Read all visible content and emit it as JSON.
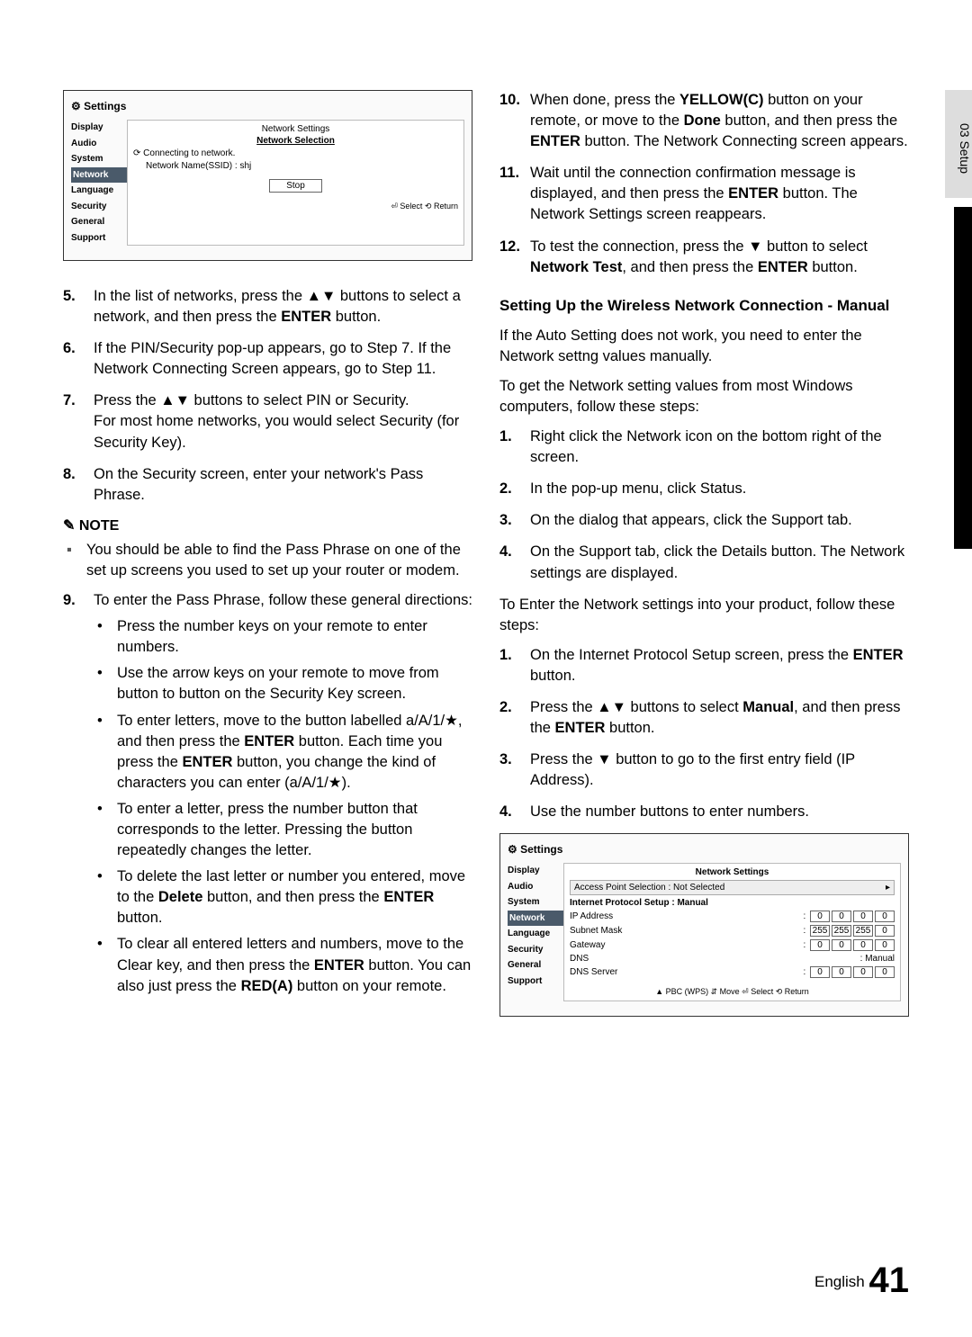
{
  "sideTab": "03  Setup",
  "screenshot1": {
    "title": "Settings",
    "menu": [
      "Display",
      "Audio",
      "System",
      "Network",
      "Language",
      "Security",
      "General",
      "Support"
    ],
    "heading": "Network Settings",
    "sub": "Network Selection",
    "connecting": "Connecting to network.",
    "ssid": "Network Name(SSID) : shj",
    "stop": "Stop",
    "footer": "⏎ Select   ⟲ Return"
  },
  "left": {
    "i5": {
      "n": "5.",
      "t": "In the list of networks, press the ▲▼ buttons to select a network, and then press the <b>ENTER</b> button."
    },
    "i6": {
      "n": "6.",
      "t": "If the PIN/Security pop-up appears, go to Step 7. If the Network Connecting Screen appears, go to Step 11."
    },
    "i7": {
      "n": "7.",
      "t": "Press the ▲▼ buttons to select PIN or Security.<br>For most home networks, you would select Security (for Security Key)."
    },
    "i8": {
      "n": "8.",
      "t": "On the Security screen, enter your network's Pass Phrase."
    },
    "noteLabel": "NOTE",
    "note": "You should be able to find the Pass Phrase on one of the set up screens you used to set up your router or modem.",
    "i9": {
      "n": "9.",
      "t": "To enter the Pass Phrase, follow these general directions:"
    },
    "b1": "Press the number keys on your remote to enter numbers.",
    "b2": "Use the arrow keys on your remote to move from button to button on the Security Key screen.",
    "b3": "To enter letters, move to the button labelled a/A/1/★, and then press the <b>ENTER</b> button. Each time you press the <b>ENTER</b> button, you change the kind of characters you can enter (a/A/1/★).",
    "b4": "To enter a letter, press the number button that corresponds to the letter. Pressing the button repeatedly changes the letter.",
    "b5": "To delete the last letter or number you entered, move to the <b>Delete</b> button, and then press the <b>ENTER</b> button.",
    "b6": "To clear all entered letters and numbers, move to the Clear key, and then press the <b>ENTER</b> button. You can also just press the <b>RED(A)</b> button on your remote."
  },
  "right": {
    "i10": {
      "n": "10.",
      "t": "When done, press the <b>YELLOW(C)</b> button on your remote, or move to the <b>Done</b> button, and then press the <b>ENTER</b> button. The Network Connecting screen appears."
    },
    "i11": {
      "n": "11.",
      "t": "Wait until the connection confirmation message is displayed, and then press the <b>ENTER</b> button. The Network Settings screen reappears."
    },
    "i12": {
      "n": "12.",
      "t": "To test the connection, press the ▼ button to select <b>Network Test</b>, and then press the <b>ENTER</b> button."
    },
    "secTitle": "Setting Up the Wireless Network Connection - Manual",
    "p1": "If the Auto Setting does not work, you need to enter the Network settng values manually.",
    "p2": "To get the Network setting values from most Windows computers, follow these steps:",
    "s1": {
      "n": "1.",
      "t": "Right click the Network icon on the bottom right of the screen."
    },
    "s2": {
      "n": "2.",
      "t": "In the pop-up menu, click Status."
    },
    "s3": {
      "n": "3.",
      "t": "On the dialog that appears, click the Support tab."
    },
    "s4": {
      "n": "4.",
      "t": "On the Support tab, click the Details button. The Network settings are displayed."
    },
    "p3": "To Enter the Network settings into your product, follow these steps:",
    "t1": {
      "n": "1.",
      "t": "On the Internet Protocol Setup screen, press the <b>ENTER</b> button."
    },
    "t2": {
      "n": "2.",
      "t": "Press the ▲▼ buttons to select <b>Manual</b>, and then press the <b>ENTER</b> button."
    },
    "t3": {
      "n": "3.",
      "t": "Press the ▼ button to go to the first entry field (IP Address)."
    },
    "t4": {
      "n": "4.",
      "t": "Use the number buttons to enter numbers."
    }
  },
  "screenshot2": {
    "title": "Settings",
    "menu": [
      "Display",
      "Audio",
      "System",
      "Network",
      "Language",
      "Security",
      "General",
      "Support"
    ],
    "heading": "Network Settings",
    "aps": "Access Point Selection : Not Selected",
    "ips": "Internet Protocol Setup : Manual",
    "ip_label": "IP Address",
    "ip": [
      "0",
      "0",
      "0",
      "0"
    ],
    "sm_label": "Subnet Mask",
    "sm": [
      "255",
      "255",
      "255",
      "0"
    ],
    "gw_label": "Gateway",
    "gw": [
      "0",
      "0",
      "0",
      "0"
    ],
    "dns_label": "DNS",
    "dns_val": ": Manual",
    "ds_label": "DNS Server",
    "ds": [
      "0",
      "0",
      "0",
      "0"
    ],
    "footer": "▲ PBC (WPS)   ⇵ Move   ⏎ Select   ⟲ Return"
  },
  "footer": {
    "lang": "English",
    "page": "41"
  }
}
